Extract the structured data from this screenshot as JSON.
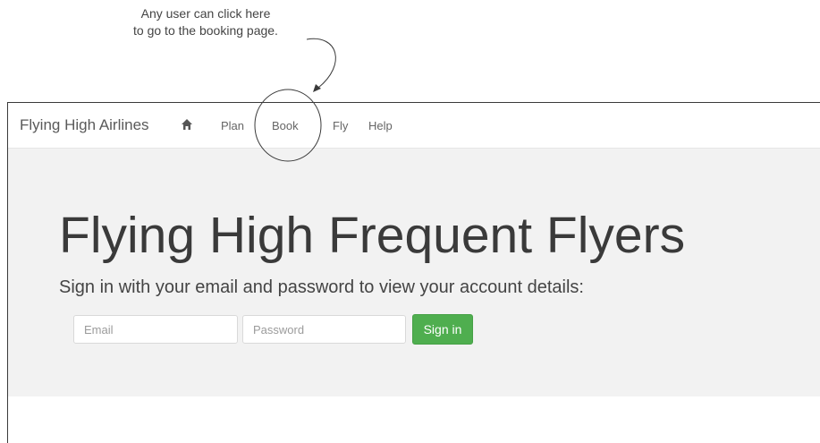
{
  "callout": {
    "line1": "Any user can click here",
    "line2": "to go to the booking page."
  },
  "navbar": {
    "brand": "Flying High Airlines",
    "home_icon": "home-icon",
    "items": [
      {
        "label": "Plan"
      },
      {
        "label": "Book"
      },
      {
        "label": "Fly"
      },
      {
        "label": "Help"
      }
    ]
  },
  "hero": {
    "title": "Flying High Frequent Flyers",
    "subtitle": "Sign in with your email and password to view your account details:"
  },
  "form": {
    "email_placeholder": "Email",
    "password_placeholder": "Password",
    "signin_label": "Sign in"
  },
  "colors": {
    "signin_button": "#4fae4f",
    "hero_background": "#f2f2f2"
  }
}
